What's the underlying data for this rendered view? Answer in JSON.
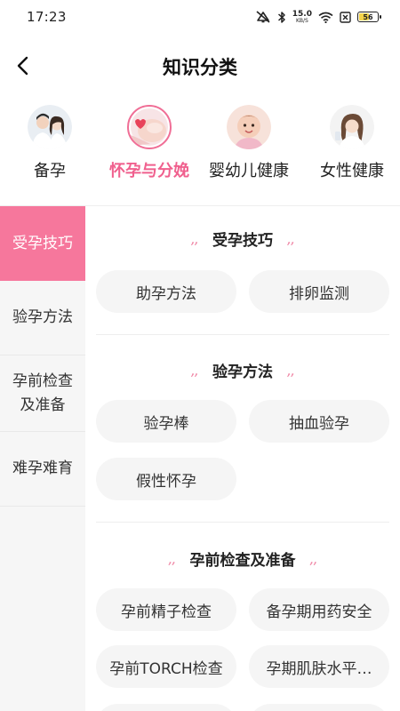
{
  "status_bar": {
    "time": "17:23",
    "speed_value": "15.0",
    "speed_unit": "KB/S",
    "battery_level": "56",
    "icons": [
      "mute-icon",
      "bluetooth-icon",
      "wifi-icon",
      "sim-off-icon",
      "battery-icon"
    ]
  },
  "nav": {
    "back_icon": "chevron-left-icon",
    "title": "知识分类"
  },
  "categories": [
    {
      "label": "备孕",
      "icon": "couple-avatar",
      "active": false
    },
    {
      "label": "怀孕与分娩",
      "icon": "pregnant-belly-avatar",
      "active": true
    },
    {
      "label": "婴幼儿健康",
      "icon": "baby-avatar",
      "active": false
    },
    {
      "label": "女性健康",
      "icon": "woman-avatar",
      "active": false
    }
  ],
  "sidebar": {
    "items": [
      {
        "label": "受孕技巧",
        "active": true
      },
      {
        "label": "验孕方法",
        "active": false
      },
      {
        "label": "孕前检查\n及准备",
        "active": false
      },
      {
        "label": "难孕难育",
        "active": false
      }
    ]
  },
  "sections": [
    {
      "title": "受孕技巧",
      "items": [
        "助孕方法",
        "排卵监测"
      ]
    },
    {
      "title": "验孕方法",
      "items": [
        "验孕棒",
        "抽血验孕",
        "假性怀孕"
      ]
    },
    {
      "title": "孕前检查及准备",
      "items": [
        "孕前精子检查",
        "备孕期用药安全",
        "孕前TORCH检查",
        "孕期肌肤水平…"
      ]
    }
  ],
  "colors": {
    "accent": "#f0608e",
    "sidebar_active_bg": "#f6779c",
    "chip_bg": "#f5f5f5",
    "sidebar_bg": "#f6f6f6"
  }
}
